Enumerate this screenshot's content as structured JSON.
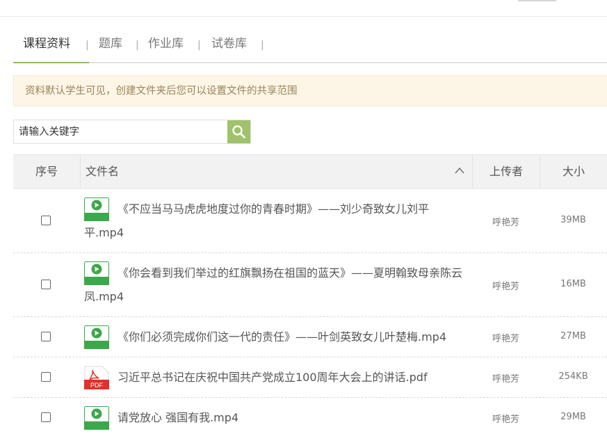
{
  "tabs": [
    {
      "label": "课程资料",
      "active": true
    },
    {
      "label": "题库",
      "active": false
    },
    {
      "label": "作业库",
      "active": false
    },
    {
      "label": "试卷库",
      "active": false
    }
  ],
  "tab_separator": "|",
  "notice": "资料默认学生可见，创建文件夹后您可以设置文件的共享范围",
  "search": {
    "placeholder": "请输入关键字",
    "icon": "search-icon"
  },
  "table": {
    "headers": {
      "seq": "序号",
      "name": "文件名",
      "uploader": "上传者",
      "size": "大小"
    },
    "sort_icon": "chevron-up-icon",
    "rows": [
      {
        "icon": "video-file-icon",
        "name": "《不应当马马虎虎地度过你的青春时期》——刘少奇致女儿刘平平.mp4",
        "uploader": "呼艳芳",
        "size": "39MB"
      },
      {
        "icon": "video-file-icon",
        "name": "《你会看到我们举过的红旗飘扬在祖国的蓝天》——夏明翰致母亲陈云凤.mp4",
        "uploader": "呼艳芳",
        "size": "16MB"
      },
      {
        "icon": "video-file-icon",
        "name": "《你们必须完成你们这一代的责任》——叶剑英致女儿叶楚梅.mp4",
        "uploader": "呼艳芳",
        "size": "27MB"
      },
      {
        "icon": "pdf-file-icon",
        "name": "习近平总书记在庆祝中国共产党成立100周年大会上的讲话.pdf",
        "uploader": "呼艳芳",
        "size": "254KB"
      },
      {
        "icon": "video-file-icon",
        "name": "请党放心 强国有我.mp4",
        "uploader": "呼艳芳",
        "size": "29MB"
      }
    ]
  },
  "pdf_badge": "PDF",
  "colors": {
    "accent": "#8fba5e",
    "search_button": "#9fc26a",
    "notice_bg": "#fdf6e7",
    "notice_text": "#9b8357",
    "video_icon": "#3ca84a",
    "pdf_icon": "#e0322a"
  }
}
